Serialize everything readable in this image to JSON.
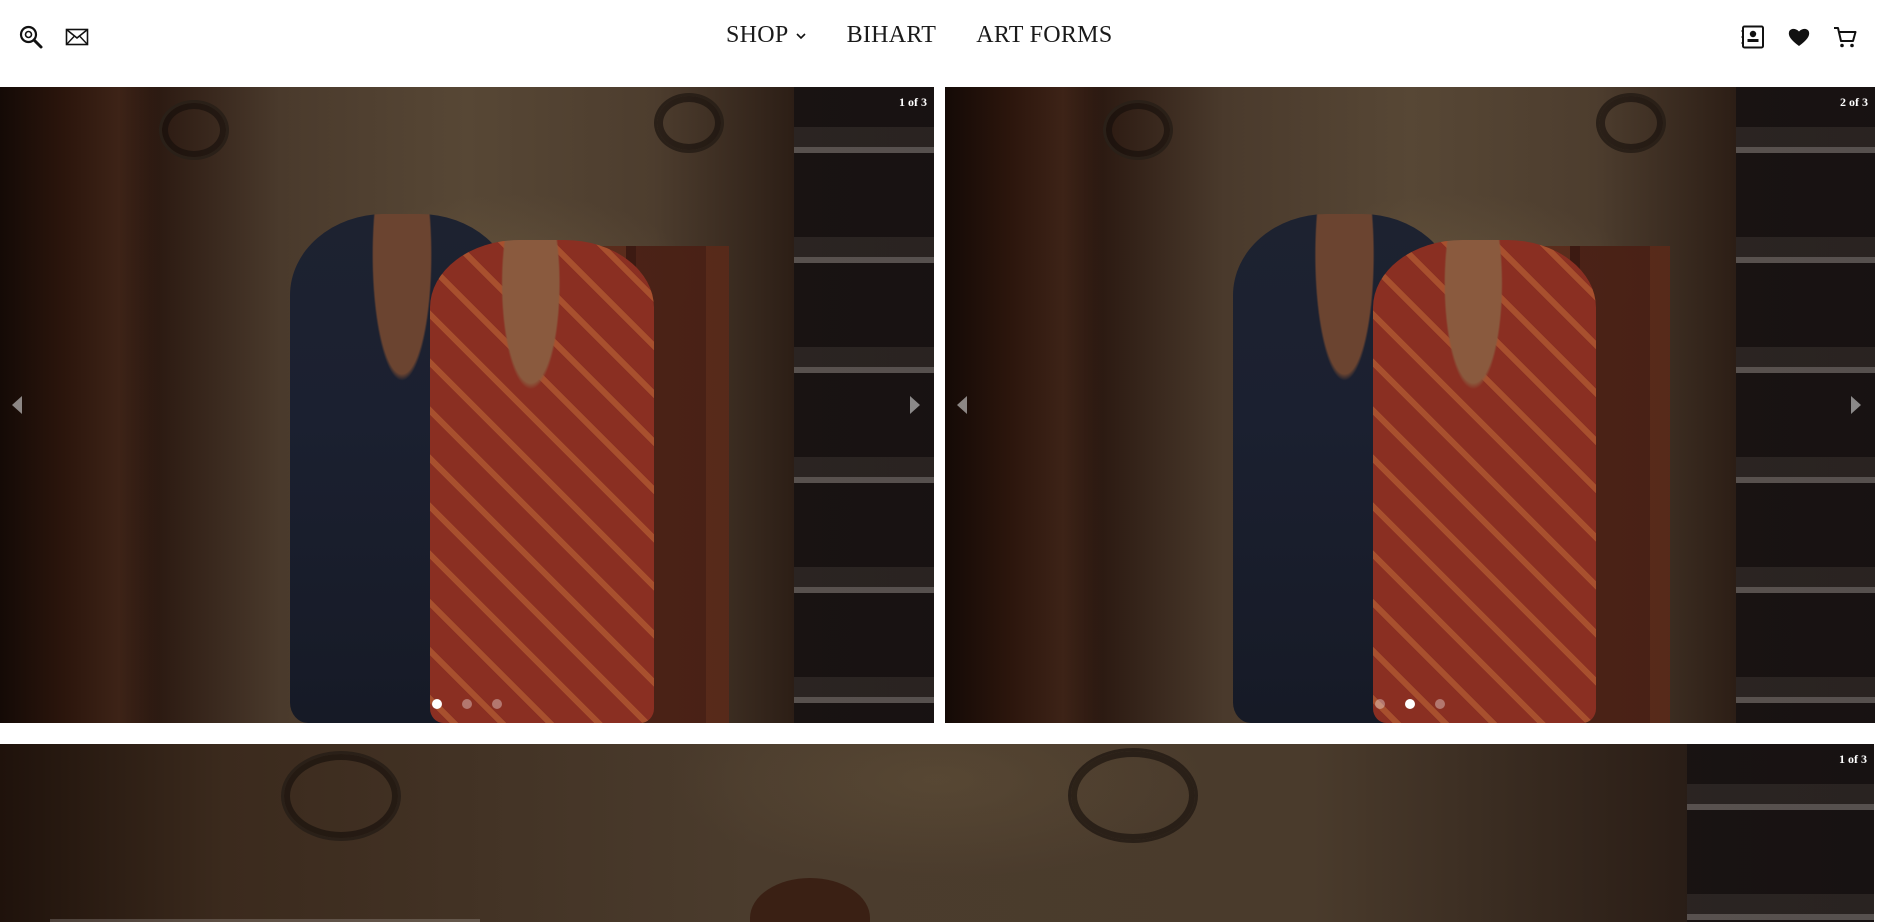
{
  "header": {
    "nav": [
      {
        "label": "SHOP",
        "has_dropdown": true
      },
      {
        "label": "BIHART",
        "has_dropdown": false
      },
      {
        "label": "ART FORMS",
        "has_dropdown": false
      }
    ],
    "left_icons": [
      "search-icon",
      "mail-icon"
    ],
    "right_icons": [
      "account-icon",
      "wishlist-heart-icon",
      "cart-icon"
    ]
  },
  "slides": [
    {
      "counter": "1 of 3",
      "active_dot": 1,
      "dot_count": 3
    },
    {
      "counter": "2 of 3",
      "active_dot": 2,
      "dot_count": 3
    },
    {
      "counter": "1 of 3"
    }
  ],
  "colors": {
    "background": "#ffffff",
    "nav_text": "#1a1a1a",
    "counter_text": "#ffffff"
  }
}
